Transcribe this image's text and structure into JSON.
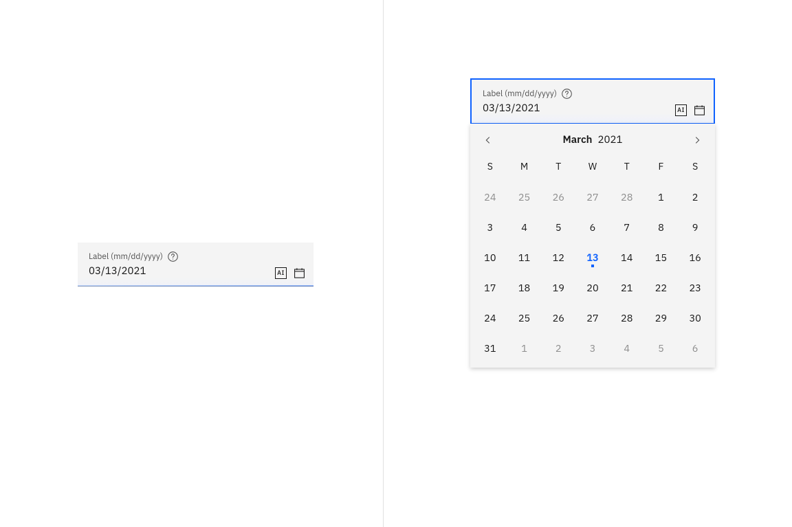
{
  "left": {
    "label": "Label (mm/dd/yyyy)",
    "value": "03/13/2021"
  },
  "right": {
    "label": "Label (mm/dd/yyyy)",
    "value": "03/13/2021"
  },
  "calendar": {
    "month": "March",
    "year": "2021",
    "dow": [
      "S",
      "M",
      "T",
      "W",
      "T",
      "F",
      "S"
    ],
    "selected": "13",
    "grid": [
      {
        "n": "24",
        "out": true
      },
      {
        "n": "25",
        "out": true
      },
      {
        "n": "26",
        "out": true
      },
      {
        "n": "27",
        "out": true
      },
      {
        "n": "28",
        "out": true
      },
      {
        "n": "1"
      },
      {
        "n": "2"
      },
      {
        "n": "3"
      },
      {
        "n": "4"
      },
      {
        "n": "5"
      },
      {
        "n": "6"
      },
      {
        "n": "7"
      },
      {
        "n": "8"
      },
      {
        "n": "9"
      },
      {
        "n": "10"
      },
      {
        "n": "11"
      },
      {
        "n": "12"
      },
      {
        "n": "13",
        "sel": true
      },
      {
        "n": "14"
      },
      {
        "n": "15"
      },
      {
        "n": "16"
      },
      {
        "n": "17"
      },
      {
        "n": "18"
      },
      {
        "n": "19"
      },
      {
        "n": "20"
      },
      {
        "n": "21"
      },
      {
        "n": "22"
      },
      {
        "n": "23"
      },
      {
        "n": "24"
      },
      {
        "n": "25"
      },
      {
        "n": "26"
      },
      {
        "n": "27"
      },
      {
        "n": "28"
      },
      {
        "n": "29"
      },
      {
        "n": "30"
      },
      {
        "n": "31"
      },
      {
        "n": "1",
        "out": true
      },
      {
        "n": "2",
        "out": true
      },
      {
        "n": "3",
        "out": true
      },
      {
        "n": "4",
        "out": true
      },
      {
        "n": "5",
        "out": true
      },
      {
        "n": "6",
        "out": true
      }
    ]
  },
  "ai_label": "AI"
}
